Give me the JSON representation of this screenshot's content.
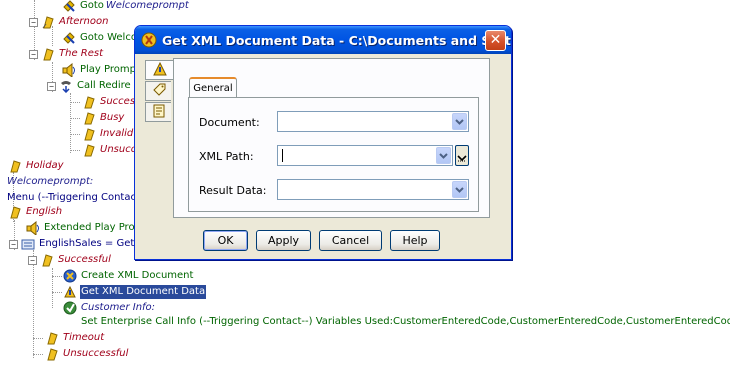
{
  "tree": {
    "rows": [
      {
        "label": "Goto ",
        "label2": "Welcomeprompt"
      },
      {
        "label": "Afternoon"
      },
      {
        "label": "Goto Welco"
      },
      {
        "label": "The Rest"
      },
      {
        "label": "Play Prompt"
      },
      {
        "label": "Call Redire"
      },
      {
        "label": "Succes"
      },
      {
        "label": "Busy"
      },
      {
        "label": "Invalid"
      },
      {
        "label": "Unsucc"
      },
      {
        "label": "Holiday"
      },
      {
        "label": "Welcomeprompt:"
      },
      {
        "label": "Menu (--Triggering Contac"
      },
      {
        "label": "English"
      },
      {
        "label": "Extended Play Pron"
      },
      {
        "label": "EnglishSales = Get"
      },
      {
        "label": "Successful"
      },
      {
        "label": "Create XML Document"
      },
      {
        "label": "Get XML Document Data"
      },
      {
        "label": "Customer Info:"
      },
      {
        "label": "Set Enterprise Call Info (--Triggering Contact--) Variables Used:CustomerEnteredCode,CustomerEnteredCode,CustomerEnteredCode"
      },
      {
        "label": "Timeout"
      },
      {
        "label": "Unsuccessful"
      }
    ]
  },
  "dialog": {
    "title": "Get XML Document Data - C:\\Documents and Setti...",
    "close_symbol": "✕",
    "tab_label": "General",
    "fields": {
      "document_label": "Document:",
      "document_value": "",
      "xml_path_label": "XML Path:",
      "xml_path_value": "",
      "result_label": "Result Data:",
      "result_value": ""
    },
    "buttons": {
      "ok": "OK",
      "apply": "Apply",
      "cancel": "Cancel",
      "help": "Help"
    }
  },
  "colors": {
    "title_blue": "#0054e3",
    "selection": "#2a4a9b",
    "italic_red": "#a0001a",
    "green_text": "#006400"
  }
}
